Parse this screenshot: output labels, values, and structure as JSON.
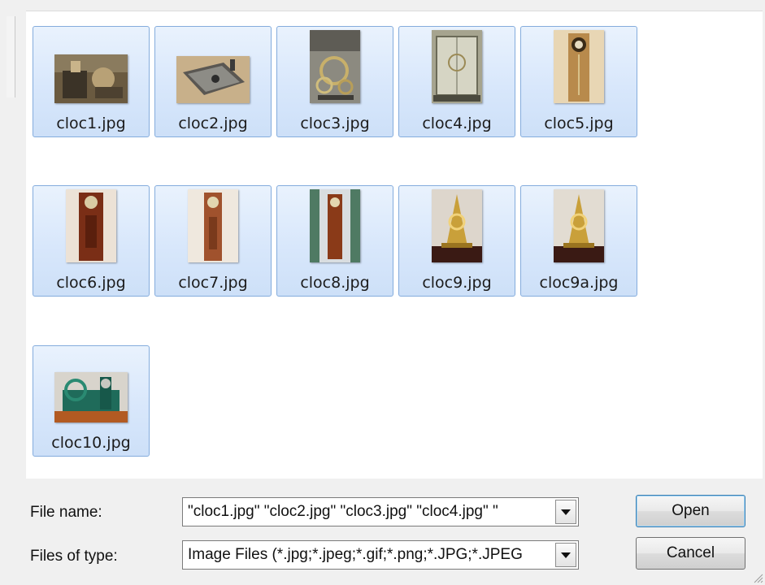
{
  "files": [
    {
      "name": "cloc1.jpg",
      "icon": "workbench-photo"
    },
    {
      "name": "cloc2.jpg",
      "icon": "clock-plate-photo"
    },
    {
      "name": "cloc3.jpg",
      "icon": "clock-mechanism-photo"
    },
    {
      "name": "cloc4.jpg",
      "icon": "glass-clock-photo"
    },
    {
      "name": "cloc5.jpg",
      "icon": "wall-clock-photo"
    },
    {
      "name": "cloc6.jpg",
      "icon": "longcase-clock-photo"
    },
    {
      "name": "cloc7.jpg",
      "icon": "longcase-clock-photo"
    },
    {
      "name": "cloc8.jpg",
      "icon": "longcase-clock-photo"
    },
    {
      "name": "cloc9.jpg",
      "icon": "skeleton-clock-photo"
    },
    {
      "name": "cloc9a.jpg",
      "icon": "skeleton-clock-photo"
    },
    {
      "name": "cloc10.jpg",
      "icon": "green-machine-photo"
    }
  ],
  "footer": {
    "file_name_label": "File name:",
    "file_name_value": "\"cloc1.jpg\" \"cloc2.jpg\" \"cloc3.jpg\" \"cloc4.jpg\" \"",
    "file_type_label": "Files of type:",
    "file_type_value": "Image Files (*.jpg;*.jpeg;*.gif;*.png;*.JPG;*.JPEG",
    "open_label": "Open",
    "cancel_label": "Cancel"
  },
  "colors": {
    "selection_border": "#84acdd",
    "selection_fill": "#d8e7fb",
    "default_button_border": "#3c7fb1"
  }
}
